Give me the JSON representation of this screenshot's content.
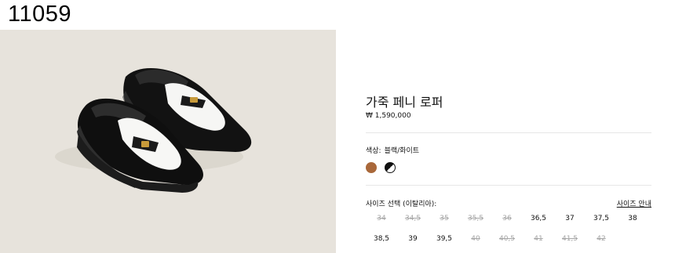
{
  "page_id": "11059",
  "product": {
    "name": "가죽 페니 로퍼",
    "price": "₩ 1,590,000"
  },
  "color": {
    "label": "색상:",
    "selected": "블랙/화이트",
    "swatches": [
      {
        "name": "brown",
        "color": "#a9683a"
      },
      {
        "name": "black-white",
        "color": "#111111"
      }
    ]
  },
  "sizes": {
    "heading": "사이즈 선택 (이탈리아):",
    "guide_label": "사이즈 안내",
    "options": [
      {
        "label": "34",
        "available": false
      },
      {
        "label": "34,5",
        "available": false
      },
      {
        "label": "35",
        "available": false
      },
      {
        "label": "35,5",
        "available": false
      },
      {
        "label": "36",
        "available": false
      },
      {
        "label": "36,5",
        "available": true
      },
      {
        "label": "37",
        "available": true
      },
      {
        "label": "37,5",
        "available": true
      },
      {
        "label": "38",
        "available": true
      },
      {
        "label": "38,5",
        "available": true
      },
      {
        "label": "39",
        "available": true
      },
      {
        "label": "39,5",
        "available": true
      },
      {
        "label": "40",
        "available": false
      },
      {
        "label": "40,5",
        "available": false
      },
      {
        "label": "41",
        "available": false
      },
      {
        "label": "41,5",
        "available": false
      },
      {
        "label": "42",
        "available": false
      }
    ]
  }
}
